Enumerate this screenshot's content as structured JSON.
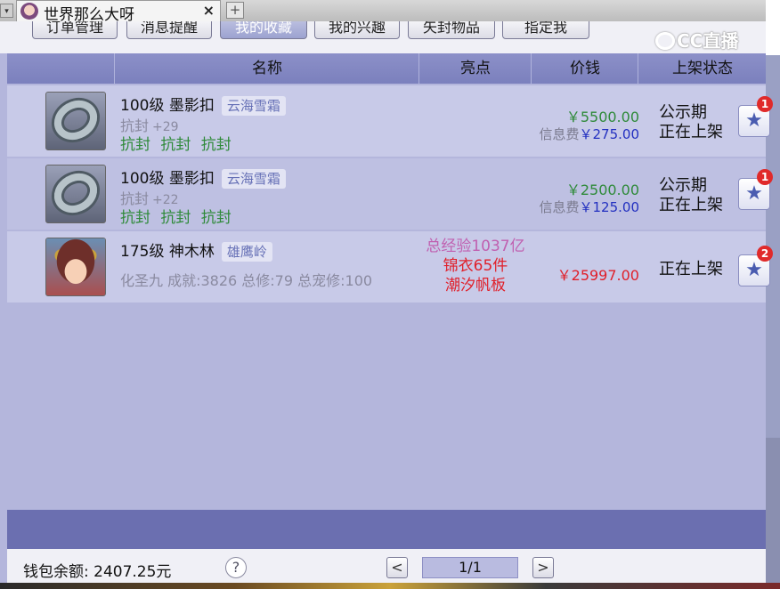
{
  "browser": {
    "tab_title": "世界那么大呀",
    "tab_close": "×",
    "tab_new": "+",
    "tab_dropdown": "▾"
  },
  "watermark": "CC直播",
  "nav": {
    "buttons": [
      "订单管理",
      "消息提醒",
      "我的收藏",
      "我的兴趣",
      "矢封物品",
      "指定我"
    ],
    "active": "我的收藏"
  },
  "table": {
    "headers": [
      "名称",
      "亮点",
      "价钱",
      "上架状态"
    ],
    "rows": [
      {
        "level_name": "100级 墨影扣",
        "server": "云海雪霜",
        "attr": "抗封",
        "attr_value": "+29",
        "tags": "抗封 抗封 抗封",
        "price": "￥5500.00",
        "fee_label": "信息费",
        "fee_amount": "￥275.00",
        "status_line1": "公示期",
        "status_line2": "正在上架",
        "fav_icon": "★",
        "fav_count": "1"
      },
      {
        "level_name": "100级 墨影扣",
        "server": "云海雪霜",
        "attr": "抗封",
        "attr_value": "+22",
        "tags": "抗封 抗封 抗封",
        "price": "￥2500.00",
        "fee_label": "信息费",
        "fee_amount": "￥125.00",
        "status_line1": "公示期",
        "status_line2": "正在上架",
        "fav_icon": "★",
        "fav_count": "1"
      },
      {
        "level_name": "175级 神木林",
        "server": "雄鹰岭",
        "stats": "化圣九 成就:3826 总修:79 总宠修:100",
        "highlights": [
          "总经验1037亿",
          "锦衣65件",
          "潮汐帆板"
        ],
        "price": "￥25997.00",
        "status_line1": "正在上架",
        "fav_icon": "★",
        "fav_count": "2"
      }
    ]
  },
  "footer": {
    "wallet": "钱包余额: 2407.25元",
    "help": "?",
    "prev": "<",
    "page": "1/1",
    "next": ">"
  },
  "colors": {
    "header_bg": "#7b80bd",
    "row_bg": "#c8cae8",
    "green_text": "#2f8a3a",
    "red_text": "#e0202a",
    "highlight_pink": "#c060b0",
    "fee_blue": "#2330c0",
    "bottom_band": "#6b6fb0"
  }
}
